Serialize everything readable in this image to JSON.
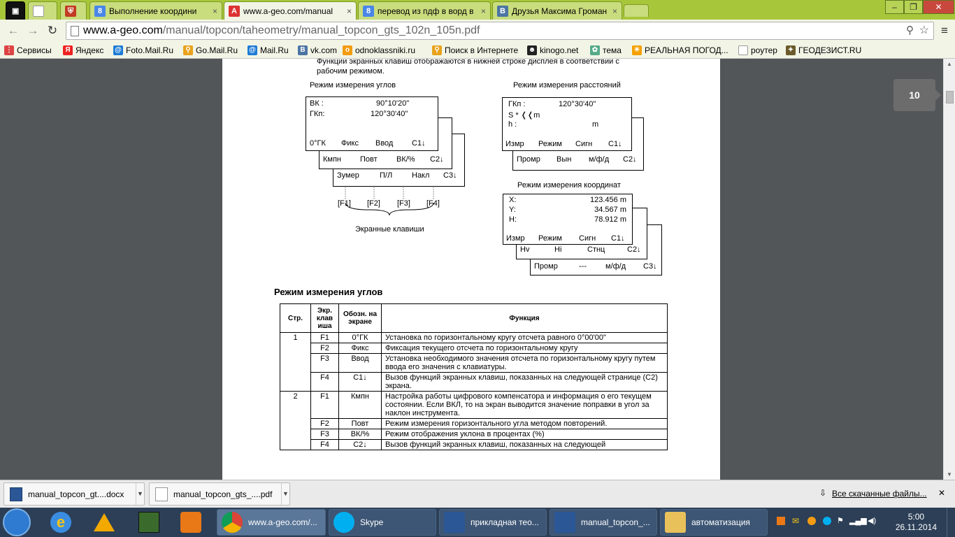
{
  "window": {
    "minimize": "–",
    "maximize": "❐",
    "close": "✕"
  },
  "tabs": [
    {
      "label": "",
      "icon": "blank-page-icon"
    },
    {
      "label": "",
      "icon": "shield-icon"
    },
    {
      "label": "Выполнение координи",
      "icon": "google-icon"
    },
    {
      "label": "www.a-geo.com/manual",
      "icon": "ageo-icon"
    },
    {
      "label": "перевод из пдф в ворд в",
      "icon": "google-icon"
    },
    {
      "label": "Друзья Максима Громан",
      "icon": "vk-icon"
    }
  ],
  "address": {
    "host": "www.a-geo.com",
    "path": "/manual/topcon/taheometry/manual_topcon_gts_102n_105n.pdf"
  },
  "bookmarks": [
    "Сервисы",
    "Яндекс",
    "Foto.Mail.Ru",
    "Go.Mail.Ru",
    "Mail.Ru",
    "vk.com",
    "odnoklassniki.ru",
    "Поиск в Интернете",
    "kinogo.net",
    "тема",
    "РЕАЛЬНАЯ ПОГОД...",
    "роутер",
    "ГЕОДЕЗИСТ.RU"
  ],
  "page": {
    "intro1": "Функции экранных клавиш отображаются в нижней строке дисплея в соответствии с",
    "intro2": "рабочим режимом.",
    "angle": {
      "title": "Режим измерения углов",
      "vk": "ВК  :",
      "vk_val": "90°10'20\"",
      "gk": "ГКп:",
      "gk_val": "120°30'40\"",
      "p1": [
        "0°ГК",
        "Фикс",
        "Ввод",
        "С1↓"
      ],
      "p2": [
        "Кмпн",
        "Повт",
        "ВК/%",
        "С2↓"
      ],
      "p3": [
        "Зумер",
        "П/Л",
        "Накл",
        "С3↓"
      ],
      "fkeys": [
        "[F1]",
        "[F2]",
        "[F3]",
        "[F4]"
      ],
      "brace_label": "Экранные клавиши"
    },
    "dist": {
      "title": "Режим измерения расстояний",
      "l1": "ГКп  :",
      "v1": "120°30'40\"",
      "l2": "S *  ❬❬m",
      "l3": "h    :",
      "v3": "m",
      "p1": [
        "Измр",
        "Режим",
        "Сигн",
        "С1↓"
      ],
      "p2": [
        "Промр",
        "Вын",
        "м/ф/д",
        "С2↓"
      ]
    },
    "coord": {
      "title": "Режим измерения координат",
      "rows": [
        {
          "k": "X:",
          "v": "123.456 m"
        },
        {
          "k": "Y:",
          "v": "34.567 m"
        },
        {
          "k": "H:",
          "v": "78.912 m"
        }
      ],
      "p1": [
        "Измр",
        "Режим",
        "Сигн",
        "С1↓"
      ],
      "p2": [
        "Hv",
        "Hi",
        "Стнц",
        "С2↓"
      ],
      "p3": [
        "Промр",
        "---",
        "м/ф/д",
        "С3↓"
      ]
    },
    "section": "Режим измерения углов",
    "table": {
      "headers": [
        "Стр.",
        "Экр. клав иша",
        "Обозн. на экране",
        "Функция"
      ],
      "rows": [
        {
          "page": "1",
          "key": "F1",
          "label": "0°ГК",
          "func": "Установка по горизонтальному кругу отсчета равного 0°00'00\""
        },
        {
          "page": "",
          "key": "F2",
          "label": "Фикс",
          "func": "Фиксация текущего отсчета по горизонтальному кругу"
        },
        {
          "page": "",
          "key": "F3",
          "label": "Ввод",
          "func": "Установка необходимого значения отсчета по горизонтальному кругу путем ввода его значения с клавиатуры."
        },
        {
          "page": "",
          "key": "F4",
          "label": "С1↓",
          "func": "Вызов функций экранных клавиш, показанных на следующей странице (С2) экрана."
        },
        {
          "page": "2",
          "key": "F1",
          "label": "Кмпн",
          "func": "Настройка работы цифрового компенсатора и информация о его текущем состоянии. Если ВКЛ, то на экран выводится значение поправки в угол за наклон инструмента."
        },
        {
          "page": "",
          "key": "F2",
          "label": "Повт",
          "func": "Режим измерения горизонтального угла методом повторений."
        },
        {
          "page": "",
          "key": "F3",
          "label": "ВК/%",
          "func": "Режим отображения уклона в процентах (%)"
        },
        {
          "page": "",
          "key": "F4",
          "label": "С2↓",
          "func": "Вызов функций экранных клавиш, показанных на следующей"
        }
      ]
    }
  },
  "page_indicator": "10",
  "downloads": {
    "items": [
      "manual_topcon_gt....docx",
      "manual_topcon_gts_....pdf"
    ],
    "all": "Все скачанные файлы...",
    "close": "✕"
  },
  "taskbar": {
    "items": [
      "www.a-geo.com/...",
      "Skype",
      "прикладная тео...",
      "manual_topcon_...",
      "автоматизация"
    ],
    "time": "5:00",
    "date": "26.11.2014"
  }
}
